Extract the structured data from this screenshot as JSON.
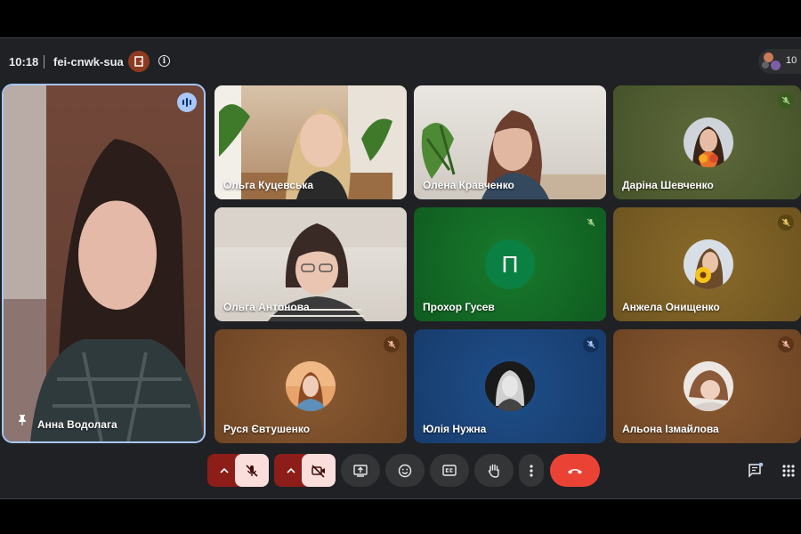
{
  "meeting": {
    "time": "10:18",
    "code": "fei-cnwk-sua",
    "participant_count": "10"
  },
  "main_tile": {
    "name": "Анна Водолага"
  },
  "tiles": [
    {
      "name": "Ольга Куцевська"
    },
    {
      "name": "Олена Кравченко"
    },
    {
      "name": "Даріна Шевченко"
    },
    {
      "name": "Ольга Антонова"
    },
    {
      "name": "Прохор Гусев",
      "initial": "П"
    },
    {
      "name": "Анжела Онищенко"
    },
    {
      "name": "Руся Євтушенко"
    },
    {
      "name": "Юлія Нужна"
    },
    {
      "name": "Альона Ізмайлова"
    }
  ],
  "colors": {
    "background": "#202124",
    "accent": "#a8c7fa",
    "control_off": "#f9dedc",
    "control_off_dark": "#8c1d18",
    "end_call": "#ea4335",
    "initial_avatar": "#0b8043"
  },
  "icons": [
    "door-icon",
    "info-icon",
    "people-icon",
    "speaking-icon",
    "pin-icon",
    "mic-off-icon",
    "camera-off-icon",
    "present-icon",
    "emoji-icon",
    "captions-icon",
    "raise-hand-icon",
    "more-icon",
    "end-call-icon",
    "chat-icon",
    "activities-icon"
  ]
}
